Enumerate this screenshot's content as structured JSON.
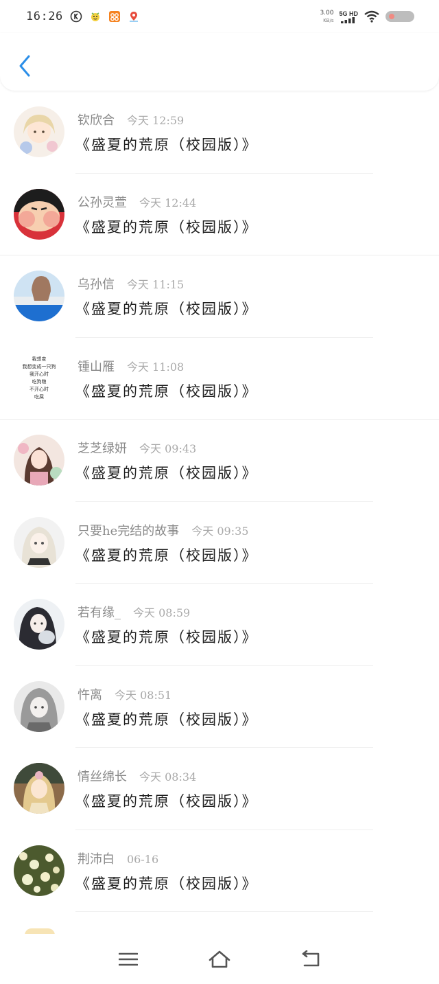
{
  "status_bar": {
    "time": "16:26",
    "net_speed_value": "3.00",
    "net_speed_unit": "KB/s",
    "net_type": "5G HD",
    "icons": [
      "k-circle-icon",
      "smiley-app-icon",
      "orange-app-icon",
      "map-pin-app-icon",
      "signal-icon",
      "wifi-icon",
      "battery-icon"
    ]
  },
  "header": {
    "back_icon": "chevron-left-icon",
    "accent": "#2b8ee8"
  },
  "items": [
    {
      "name": "钦欣合",
      "time": "今天 12:59",
      "title": "《盛夏的荒原（校园版）》"
    },
    {
      "name": "公孙灵萱",
      "time": "今天 12:44",
      "title": "《盛夏的荒原（校园版）》"
    },
    {
      "name": "乌孙信",
      "time": "今天 11:15",
      "title": "《盛夏的荒原（校园版）》"
    },
    {
      "name": "锺山雁",
      "time": "今天 11:08",
      "title": "《盛夏的荒原（校园版）》"
    },
    {
      "name": "芝芝绿妍",
      "time": "今天 09:43",
      "title": "《盛夏的荒原（校园版）》"
    },
    {
      "name": "只要he完结的故事",
      "time": "今天 09:35",
      "title": "《盛夏的荒原（校园版）》"
    },
    {
      "name": "若有缘_",
      "time": "今天 08:59",
      "title": "《盛夏的荒原（校园版）》"
    },
    {
      "name": "忤离",
      "time": "今天 08:51",
      "title": "《盛夏的荒原（校园版）》"
    },
    {
      "name": "情丝绵长",
      "time": "今天 08:34",
      "title": "《盛夏的荒原（校园版）》"
    },
    {
      "name": "荆沛白",
      "time": "06-16",
      "title": "《盛夏的荒原（校园版）》"
    }
  ],
  "text_avatar_lines": [
    "我想变",
    "我想变成一只狗",
    "我开心时",
    "吃狗粮",
    "不开心时",
    "吃屎"
  ],
  "navbar": {
    "icons": [
      "menu-icon",
      "home-icon",
      "back-icon"
    ]
  }
}
